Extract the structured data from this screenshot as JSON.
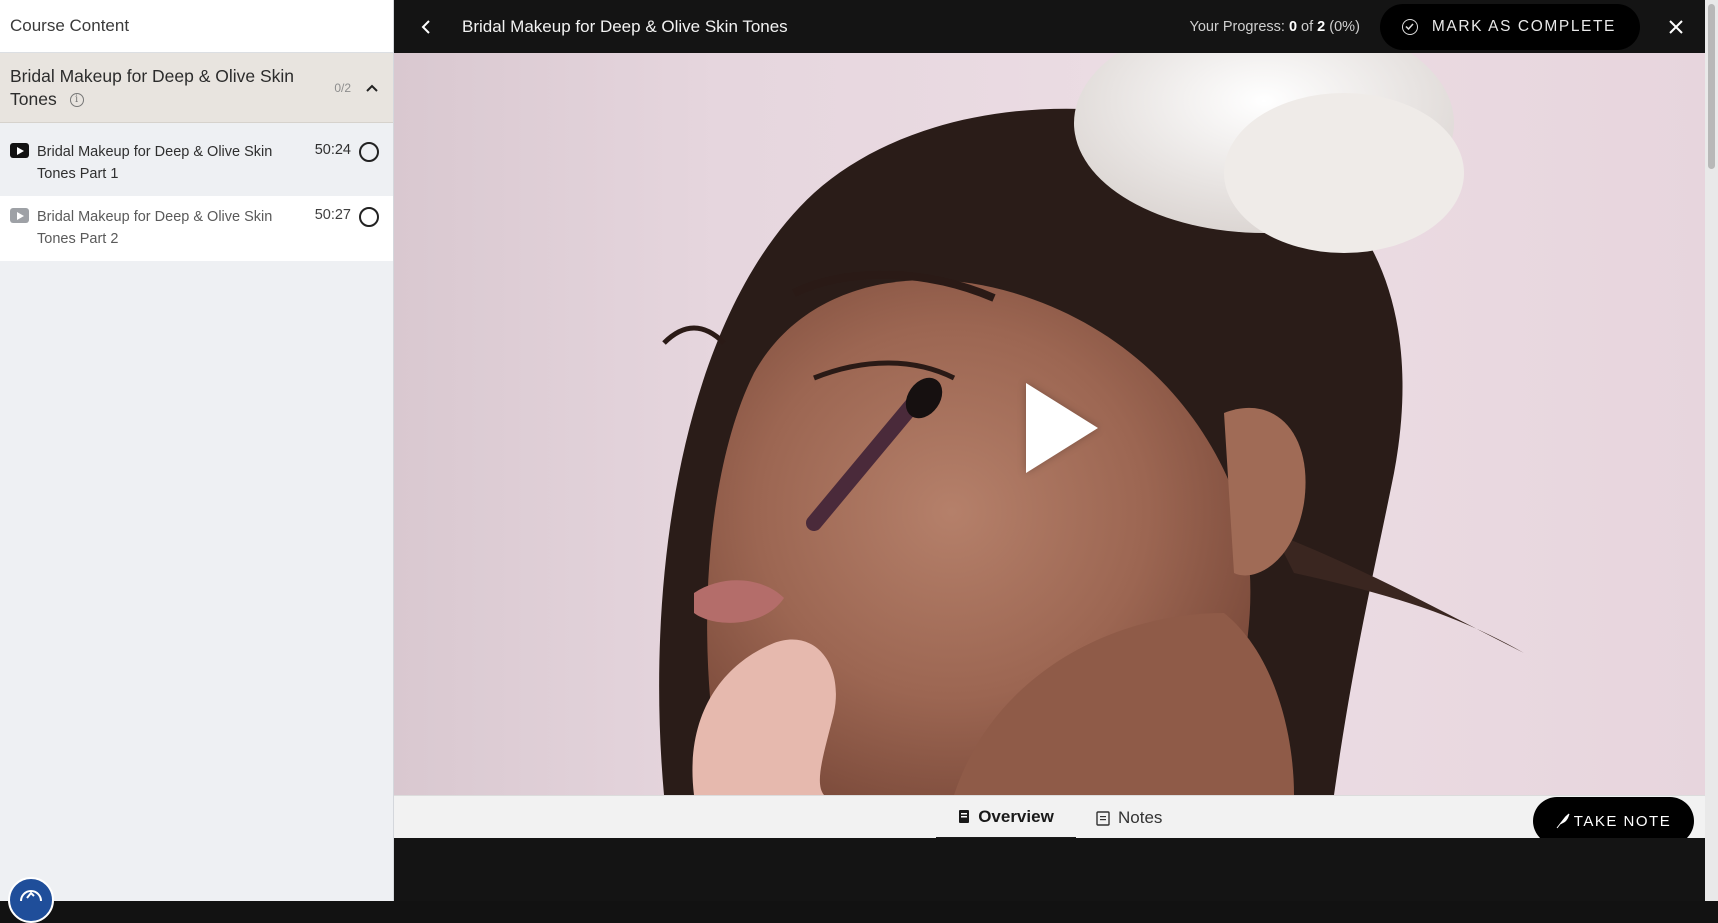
{
  "sidebar": {
    "header": "Course Content",
    "section": {
      "title": "Bridal Makeup for Deep & Olive Skin Tones",
      "count": "0/2",
      "info_icon": "i"
    },
    "lessons": [
      {
        "title": "Bridal Makeup for Deep & Olive Skin Tones Part 1",
        "duration": "50:24",
        "active": true
      },
      {
        "title": "Bridal Makeup for Deep & Olive Skin Tones Part 2",
        "duration": "50:27",
        "active": false
      }
    ]
  },
  "topbar": {
    "title": "Bridal Makeup for Deep & Olive Skin Tones",
    "progress_label": "Your Progress: ",
    "progress_done": "0",
    "progress_of": " of ",
    "progress_total": "2",
    "progress_pct": " (0%)",
    "mark_complete": "MARK AS COMPLETE"
  },
  "tabs": {
    "overview": "Overview",
    "notes": "Notes"
  },
  "take_note": "TAKE NOTE",
  "colors": {
    "accent": "#000000",
    "topbar": "#141414",
    "sidebar_bg": "#eef0f3",
    "section_bg": "#e8e4df"
  }
}
